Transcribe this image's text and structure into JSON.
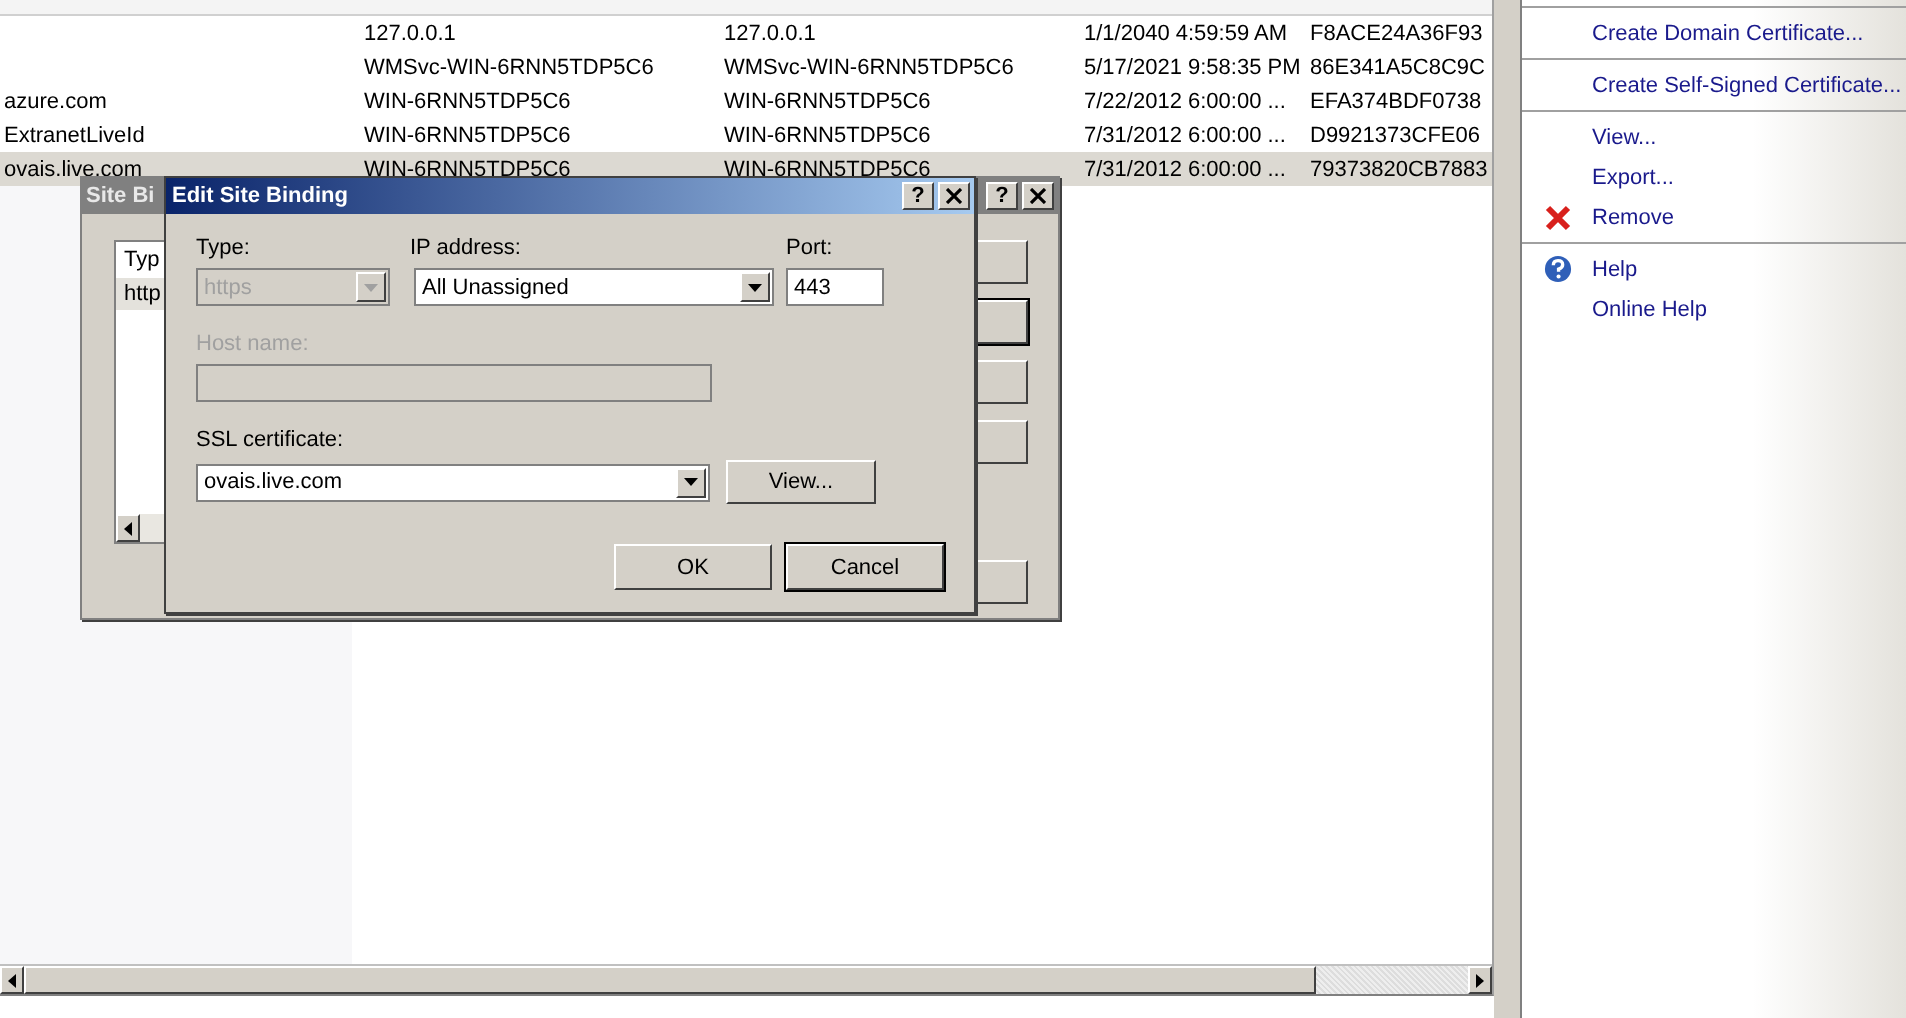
{
  "table": {
    "rows": [
      {
        "cells": [
          "",
          "127.0.0.1",
          "127.0.0.1",
          "1/1/2040 4:59:59 AM",
          "F8ACE24A36F93"
        ],
        "selected": false
      },
      {
        "cells": [
          "",
          "WMSvc-WIN-6RNN5TDP5C6",
          "WMSvc-WIN-6RNN5TDP5C6",
          "5/17/2021 9:58:35 PM",
          "86E341A5C8C9C"
        ],
        "selected": false
      },
      {
        "cells": [
          "azure.com",
          "WIN-6RNN5TDP5C6",
          "WIN-6RNN5TDP5C6",
          "7/22/2012 6:00:00 ...",
          "EFA374BDF0738"
        ],
        "selected": false
      },
      {
        "cells": [
          "ExtranetLiveId",
          "WIN-6RNN5TDP5C6",
          "WIN-6RNN5TDP5C6",
          "7/31/2012 6:00:00 ...",
          "D9921373CFE06"
        ],
        "selected": false
      },
      {
        "cells": [
          "ovais.live.com",
          "WIN-6RNN5TDP5C6",
          "WIN-6RNN5TDP5C6",
          "7/31/2012 6:00:00 ...",
          "79373820CB7883"
        ],
        "selected": true
      }
    ]
  },
  "actions": [
    {
      "label": "Create Domain Certificate...",
      "kind": "plain",
      "divider_before": true
    },
    {
      "label": "Create Self-Signed Certificate...",
      "kind": "plain",
      "divider_before": true
    },
    {
      "label": "View...",
      "kind": "plain",
      "divider_before": true
    },
    {
      "label": "Export...",
      "kind": "plain",
      "divider_before": false
    },
    {
      "label": "Remove",
      "kind": "remove",
      "divider_before": false
    },
    {
      "label": "Help",
      "kind": "help",
      "divider_before": true
    },
    {
      "label": "Online Help",
      "kind": "plain",
      "divider_before": false
    }
  ],
  "site_bindings_dialog": {
    "title": "Site Bi",
    "help_button": "?",
    "list_header": "Typ",
    "list_row": "http"
  },
  "edit_dialog": {
    "title": "Edit Site Binding",
    "help_button": "?",
    "type": {
      "label": "Type:",
      "value": "https",
      "disabled": true
    },
    "ip_address": {
      "label": "IP address:",
      "value": "All Unassigned"
    },
    "port": {
      "label": "Port:",
      "value": "443"
    },
    "host_name": {
      "label": "Host name:",
      "disabled": true
    },
    "ssl_certificate": {
      "label": "SSL certificate:",
      "value": "ovais.live.com"
    },
    "view_button": "View...",
    "buttons": [
      {
        "label": "OK",
        "default": false
      },
      {
        "label": "Cancel",
        "default": true
      }
    ]
  }
}
